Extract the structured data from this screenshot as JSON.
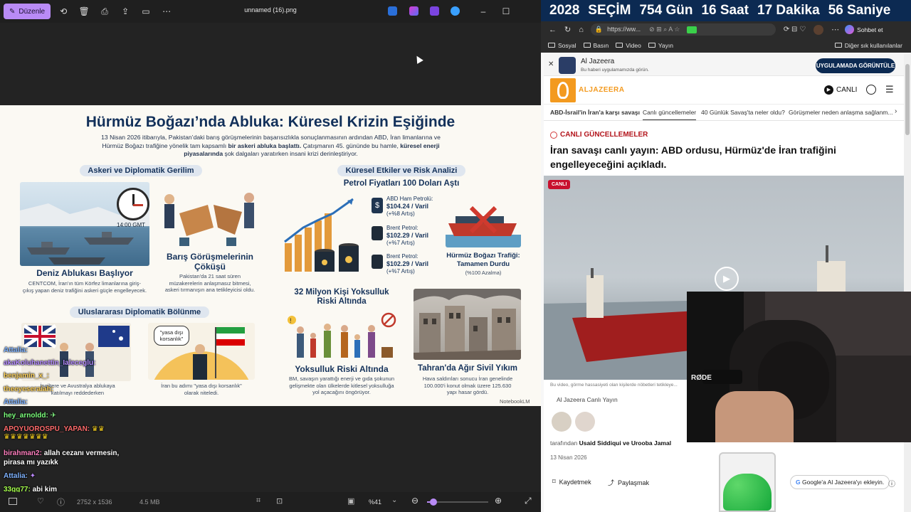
{
  "viewer": {
    "edit_label": "Düzenle",
    "filename": "unnamed (16).png",
    "dimensions": "2752 x 1536",
    "filesize": "4.5 MB",
    "zoom": "%41",
    "zoom_level": 0.41
  },
  "infographic": {
    "title": "Hürmüz Boğazı’nda Abluka: Küresel Krizin Eşiğinde",
    "intro_1": "13 Nisan 2026 itibarıyla, Pakistan’daki barış görüşmelerinin başarısızlıkla sonuçlanmasının ardından ABD, İran limanlarına ve",
    "intro_2_a": "Hürmüz Boğazı trafiğine yönelik tam kapsamlı ",
    "intro_2_b": "bir askeri abluka başlattı.",
    "intro_2_c": " Çatışmanın 45. gününde bu hamle, ",
    "intro_2_d": "küresel enerji",
    "intro_3_a": "piyasalarında",
    "intro_3_b": " şok dalgaları yaratırken insani krizi derinleştiriyor.",
    "left_header": "Askeri ve Diplomatik Gerilim",
    "right_header": "Küresel Etkiler ve Risk Analizi",
    "clock_label": "14:00 GMT",
    "blockade_title": "Deniz Ablukası Başlıyor",
    "blockade_desc_1": "CENTCOM, İran'ın tüm Körfez limanlarına giriş-",
    "blockade_desc_2": "çıkış yapan deniz trafiğini askeri güçle engelleyecek.",
    "talks_title_1": "Barış Görüşmelerinin",
    "talks_title_2": "Çöküşü",
    "talks_desc_1": "Pakistan'da 21 saat süren",
    "talks_desc_2": "müzakerelerin anlaşmasız bitmesi,",
    "talks_desc_3": "askeri tırmanışın ana tetikleyicisi oldu.",
    "oil_header": "Petrol Fiyatları 100 Doları Aştı",
    "oil_items": [
      {
        "name": "ABD Ham Petrolü:",
        "price": "$104.24 / Varil",
        "change": "(+%8 Artış)"
      },
      {
        "name": "Brent Petrol:",
        "price": "$102.29 / Varil",
        "change": "(+%7 Artış)"
      },
      {
        "name": "Brent Petrol:",
        "price": "$102.29 / Varil",
        "change": "(+%7 Artış)"
      }
    ],
    "traffic_title_1": "Hürmüz Boğazı Trafiği:",
    "traffic_title_2": "Tamamen Durdu",
    "traffic_desc": "(%100 Azalma)",
    "diplo_header": "Uluslararası Diplomatik Bölünme",
    "uk_desc_1": "İngiltere ve Avustralya ablukaya",
    "uk_desc_2": "katılmayı reddederken",
    "pirate_bubble_1": "\"yasa dışı",
    "pirate_bubble_2": "korsanlık\"",
    "iran_desc_1": "İran bu adımı \"yasa dışı korsanlık\"",
    "iran_desc_2": "olarak niteledi.",
    "poverty_header_1": "32 Milyon Kişi Yoksulluk",
    "poverty_header_2": "Riski Altında",
    "poverty_title": "Yoksulluk Riski Altında",
    "poverty_desc_1": "BM, savaşın yarattığı enerji ve gıda şokunun",
    "poverty_desc_2": "gelişmekte olan ülkelerde kitlesel yoksulluğa",
    "poverty_desc_3": "yol açacağını öngörüyor.",
    "tehran_title": "Tahran'da Ağır Sivil Yıkım",
    "tehran_desc_1": "Hava saldırıları sonucu İran genelinde",
    "tehran_desc_2": "100.000'i konut olmak üzere 125.630",
    "tehran_desc_3": "yapı hasar gördü.",
    "watermark": "NotebookLM"
  },
  "chat": [
    {
      "user": "Attalia:",
      "text": "",
      "color": "#7fb3ff"
    },
    {
      "user": "akaKoluhanettin_Ialeceglu:",
      "text": "",
      "color": "#b58cff"
    },
    {
      "user": "benjamin_x_:",
      "text": "",
      "color": "#ffd35c"
    },
    {
      "user": "theeyeseraiah:",
      "text": "",
      "color": "#ffd35c"
    },
    {
      "user": "Attalia:",
      "text": "",
      "color": "#7fb3ff"
    },
    {
      "user": "hey_arnoldd:",
      "text": "",
      "color": "#7cff7c"
    },
    {
      "user": "APOYUOROSPU_YAPAN:",
      "text": "",
      "color": "#ff6b6b"
    },
    {
      "user": "birahman2:",
      "text": "allah cezanı vermesin,",
      "text2": "pirasa mı yazıkk",
      "color": "#ff7fbf"
    },
    {
      "user": "Attalia:",
      "text": "",
      "color": "#7fb3ff"
    },
    {
      "user": "33gg77:",
      "text": "abi kim",
      "color": "#a6ff4d"
    }
  ],
  "banner": [
    "2028",
    "SEÇİM",
    "754 Gün",
    "16 Saat",
    "17 Dakika",
    "56 Saniye"
  ],
  "browser": {
    "url": "https://ww...",
    "chat_btn": "Sohbet et",
    "bookmarks": [
      "Sosyal",
      "Basın",
      "Video",
      "Yayın"
    ],
    "other_bookmarks": "Diğer sık kullanılanlar"
  },
  "aljazeera": {
    "app_name": "Al Jazeera",
    "app_sub": "Bu haberi uygulamamızda görün.",
    "app_btn": "UYGULAMADA GÖRÜNTÜLE",
    "logo": "ALJAZEERA",
    "live_btn": "CANLI",
    "tabs": [
      "ABD-İsrail'in İran'a karşı savaşı",
      "Canlı güncellemeler",
      "40 Günlük Savaş'ta neler oldu?",
      "Görüşmeler neden anlaşma sağlanm..."
    ],
    "live_label": "CANLI GÜNCELLEMELER",
    "headline_1": "İran savaşı canlı yayın: ABD ordusu, Hürmüz'de İran trafiğini",
    "headline_2": "engelleyeceğini açıkladı.",
    "video_badge": "CANLI",
    "caption": "Bu video, görme hassasiyeti olan kişilerde nöbetleri tetikleye...",
    "byline": "Al Jazeera Canlı Yayın",
    "authors_prefix": "tarafından",
    "authors": "Usaid Siddiqui ve Urooba Jamal",
    "date": "13 Nisan 2026",
    "save": "Kaydetmek",
    "share": "Paylaşmak",
    "google_btn": "Google'a Al Jazeera'yı ekleyin."
  },
  "webcam": {
    "mic_brand": "RØDE"
  }
}
